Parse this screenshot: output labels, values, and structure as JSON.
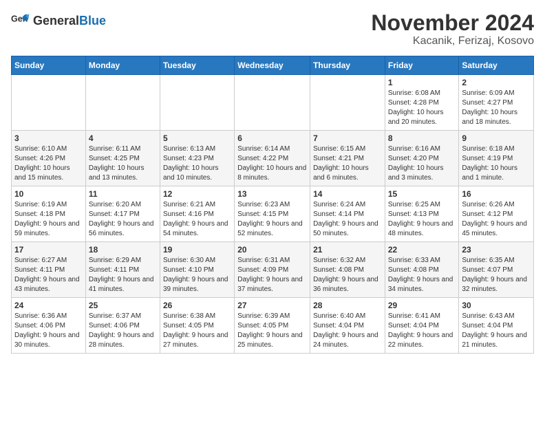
{
  "logo": {
    "text_general": "General",
    "text_blue": "Blue"
  },
  "title": "November 2024",
  "subtitle": "Kacanik, Ferizaj, Kosovo",
  "weekdays": [
    "Sunday",
    "Monday",
    "Tuesday",
    "Wednesday",
    "Thursday",
    "Friday",
    "Saturday"
  ],
  "weeks": [
    [
      {
        "day": "",
        "detail": ""
      },
      {
        "day": "",
        "detail": ""
      },
      {
        "day": "",
        "detail": ""
      },
      {
        "day": "",
        "detail": ""
      },
      {
        "day": "",
        "detail": ""
      },
      {
        "day": "1",
        "detail": "Sunrise: 6:08 AM\nSunset: 4:28 PM\nDaylight: 10 hours and 20 minutes."
      },
      {
        "day": "2",
        "detail": "Sunrise: 6:09 AM\nSunset: 4:27 PM\nDaylight: 10 hours and 18 minutes."
      }
    ],
    [
      {
        "day": "3",
        "detail": "Sunrise: 6:10 AM\nSunset: 4:26 PM\nDaylight: 10 hours and 15 minutes."
      },
      {
        "day": "4",
        "detail": "Sunrise: 6:11 AM\nSunset: 4:25 PM\nDaylight: 10 hours and 13 minutes."
      },
      {
        "day": "5",
        "detail": "Sunrise: 6:13 AM\nSunset: 4:23 PM\nDaylight: 10 hours and 10 minutes."
      },
      {
        "day": "6",
        "detail": "Sunrise: 6:14 AM\nSunset: 4:22 PM\nDaylight: 10 hours and 8 minutes."
      },
      {
        "day": "7",
        "detail": "Sunrise: 6:15 AM\nSunset: 4:21 PM\nDaylight: 10 hours and 6 minutes."
      },
      {
        "day": "8",
        "detail": "Sunrise: 6:16 AM\nSunset: 4:20 PM\nDaylight: 10 hours and 3 minutes."
      },
      {
        "day": "9",
        "detail": "Sunrise: 6:18 AM\nSunset: 4:19 PM\nDaylight: 10 hours and 1 minute."
      }
    ],
    [
      {
        "day": "10",
        "detail": "Sunrise: 6:19 AM\nSunset: 4:18 PM\nDaylight: 9 hours and 59 minutes."
      },
      {
        "day": "11",
        "detail": "Sunrise: 6:20 AM\nSunset: 4:17 PM\nDaylight: 9 hours and 56 minutes."
      },
      {
        "day": "12",
        "detail": "Sunrise: 6:21 AM\nSunset: 4:16 PM\nDaylight: 9 hours and 54 minutes."
      },
      {
        "day": "13",
        "detail": "Sunrise: 6:23 AM\nSunset: 4:15 PM\nDaylight: 9 hours and 52 minutes."
      },
      {
        "day": "14",
        "detail": "Sunrise: 6:24 AM\nSunset: 4:14 PM\nDaylight: 9 hours and 50 minutes."
      },
      {
        "day": "15",
        "detail": "Sunrise: 6:25 AM\nSunset: 4:13 PM\nDaylight: 9 hours and 48 minutes."
      },
      {
        "day": "16",
        "detail": "Sunrise: 6:26 AM\nSunset: 4:12 PM\nDaylight: 9 hours and 45 minutes."
      }
    ],
    [
      {
        "day": "17",
        "detail": "Sunrise: 6:27 AM\nSunset: 4:11 PM\nDaylight: 9 hours and 43 minutes."
      },
      {
        "day": "18",
        "detail": "Sunrise: 6:29 AM\nSunset: 4:11 PM\nDaylight: 9 hours and 41 minutes."
      },
      {
        "day": "19",
        "detail": "Sunrise: 6:30 AM\nSunset: 4:10 PM\nDaylight: 9 hours and 39 minutes."
      },
      {
        "day": "20",
        "detail": "Sunrise: 6:31 AM\nSunset: 4:09 PM\nDaylight: 9 hours and 37 minutes."
      },
      {
        "day": "21",
        "detail": "Sunrise: 6:32 AM\nSunset: 4:08 PM\nDaylight: 9 hours and 36 minutes."
      },
      {
        "day": "22",
        "detail": "Sunrise: 6:33 AM\nSunset: 4:08 PM\nDaylight: 9 hours and 34 minutes."
      },
      {
        "day": "23",
        "detail": "Sunrise: 6:35 AM\nSunset: 4:07 PM\nDaylight: 9 hours and 32 minutes."
      }
    ],
    [
      {
        "day": "24",
        "detail": "Sunrise: 6:36 AM\nSunset: 4:06 PM\nDaylight: 9 hours and 30 minutes."
      },
      {
        "day": "25",
        "detail": "Sunrise: 6:37 AM\nSunset: 4:06 PM\nDaylight: 9 hours and 28 minutes."
      },
      {
        "day": "26",
        "detail": "Sunrise: 6:38 AM\nSunset: 4:05 PM\nDaylight: 9 hours and 27 minutes."
      },
      {
        "day": "27",
        "detail": "Sunrise: 6:39 AM\nSunset: 4:05 PM\nDaylight: 9 hours and 25 minutes."
      },
      {
        "day": "28",
        "detail": "Sunrise: 6:40 AM\nSunset: 4:04 PM\nDaylight: 9 hours and 24 minutes."
      },
      {
        "day": "29",
        "detail": "Sunrise: 6:41 AM\nSunset: 4:04 PM\nDaylight: 9 hours and 22 minutes."
      },
      {
        "day": "30",
        "detail": "Sunrise: 6:43 AM\nSunset: 4:04 PM\nDaylight: 9 hours and 21 minutes."
      }
    ]
  ]
}
